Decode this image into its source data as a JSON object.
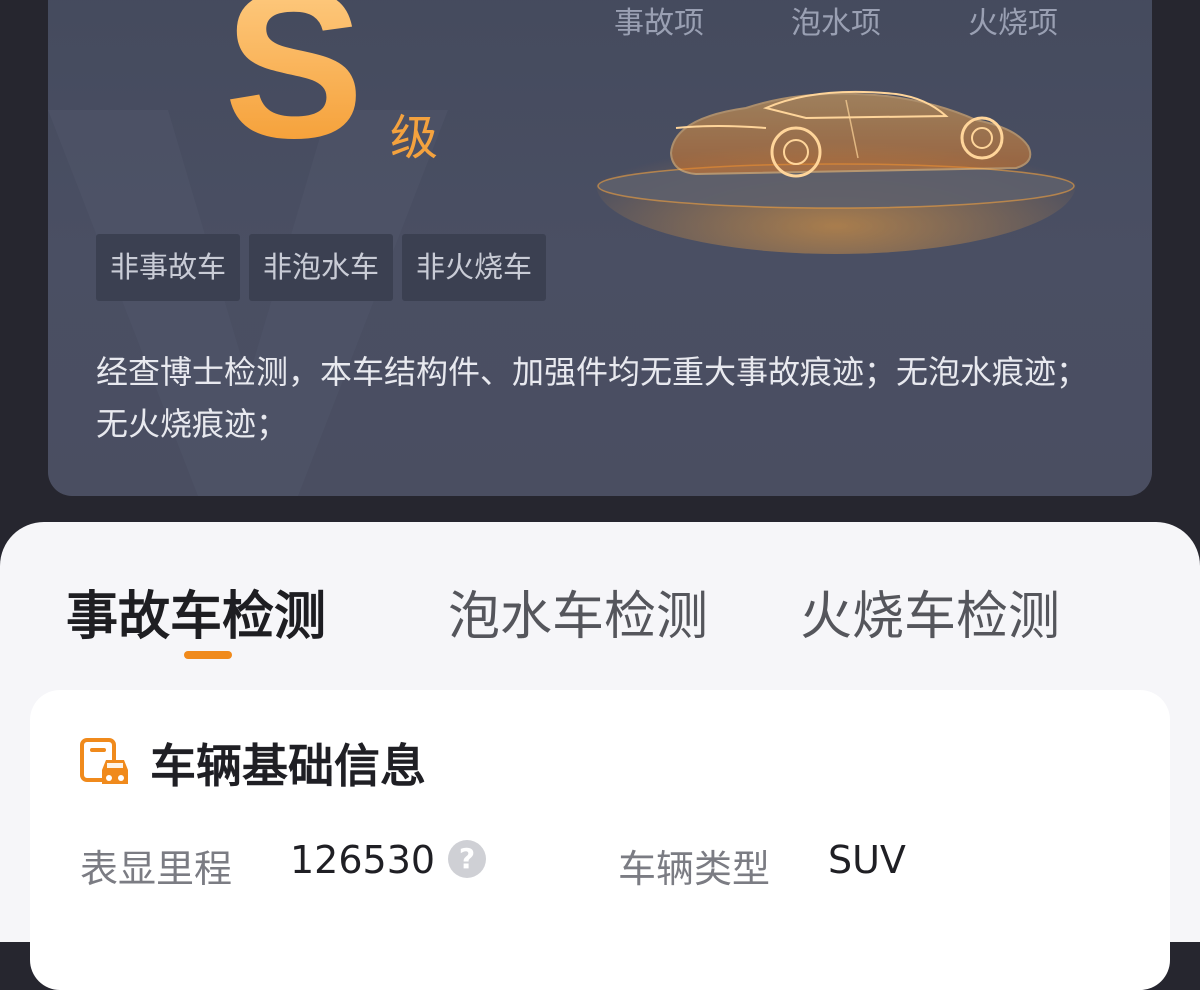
{
  "grade": {
    "letter": "S",
    "suffix": "级"
  },
  "check_items": [
    "事故项",
    "泡水项",
    "火烧项"
  ],
  "tags": [
    "非事故车",
    "非泡水车",
    "非火烧车"
  ],
  "description": "经查博士检测，本车结构件、加强件均无重大事故痕迹；无泡水痕迹；无火烧痕迹；",
  "tabs": [
    {
      "label": "事故车检测",
      "active": true
    },
    {
      "label": "泡水车检测",
      "active": false
    },
    {
      "label": "火烧车检测",
      "active": false
    }
  ],
  "info": {
    "title": "车辆基础信息",
    "icon": "document-car-icon",
    "mileage_label": "表显里程",
    "mileage_value": "126530",
    "type_label": "车辆类型",
    "type_value": "SUV"
  },
  "colors": {
    "accent": "#f08a1c",
    "grade": "#f5a33a",
    "card": "#4a4f63",
    "sheet": "#f6f6f9"
  }
}
